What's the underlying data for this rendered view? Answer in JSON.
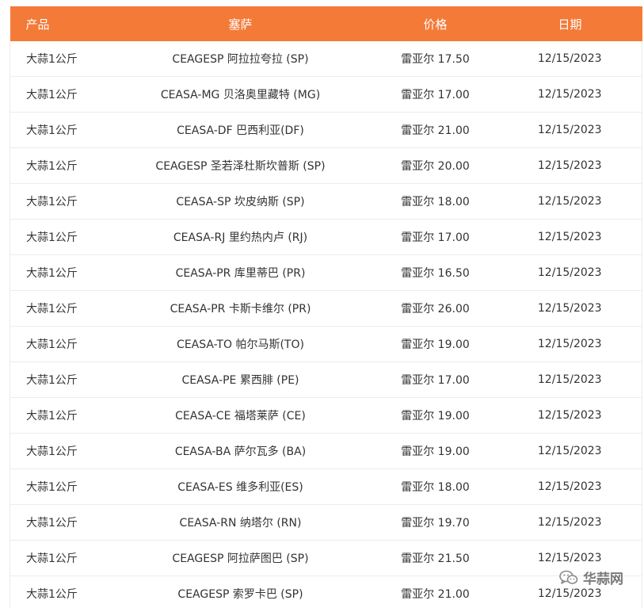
{
  "table": {
    "headers": {
      "product": "产品",
      "ceasa": "塞萨",
      "price": "价格",
      "date": "日期"
    },
    "rows": [
      {
        "product": "大蒜1公斤",
        "ceasa": "CEAGESP 阿拉拉夸拉 (SP)",
        "price": "雷亚尔 17.50",
        "date": "12/15/2023"
      },
      {
        "product": "大蒜1公斤",
        "ceasa": "CEASA-MG 贝洛奥里藏特 (MG)",
        "price": "雷亚尔 17.00",
        "date": "12/15/2023"
      },
      {
        "product": "大蒜1公斤",
        "ceasa": "CEASA-DF 巴西利亚(DF)",
        "price": "雷亚尔 21.00",
        "date": "12/15/2023"
      },
      {
        "product": "大蒜1公斤",
        "ceasa": "CEAGESP 圣若泽杜斯坎普斯 (SP)",
        "price": "雷亚尔 20.00",
        "date": "12/15/2023"
      },
      {
        "product": "大蒜1公斤",
        "ceasa": "CEASA-SP 坎皮纳斯 (SP)",
        "price": "雷亚尔 18.00",
        "date": "12/15/2023"
      },
      {
        "product": "大蒜1公斤",
        "ceasa": "CEASA-RJ 里约热内卢 (RJ)",
        "price": "雷亚尔 17.00",
        "date": "12/15/2023"
      },
      {
        "product": "大蒜1公斤",
        "ceasa": "CEASA-PR 库里蒂巴 (PR)",
        "price": "雷亚尔 16.50",
        "date": "12/15/2023"
      },
      {
        "product": "大蒜1公斤",
        "ceasa": "CEASA-PR 卡斯卡维尔 (PR)",
        "price": "雷亚尔 26.00",
        "date": "12/15/2023"
      },
      {
        "product": "大蒜1公斤",
        "ceasa": "CEASA-TO 帕尔马斯(TO)",
        "price": "雷亚尔 19.00",
        "date": "12/15/2023"
      },
      {
        "product": "大蒜1公斤",
        "ceasa": "CEASA-PE 累西腓 (PE)",
        "price": "雷亚尔 17.00",
        "date": "12/15/2023"
      },
      {
        "product": "大蒜1公斤",
        "ceasa": "CEASA-CE 福塔莱萨 (CE)",
        "price": "雷亚尔 19.00",
        "date": "12/15/2023"
      },
      {
        "product": "大蒜1公斤",
        "ceasa": "CEASA-BA 萨尔瓦多 (BA)",
        "price": "雷亚尔 19.00",
        "date": "12/15/2023"
      },
      {
        "product": "大蒜1公斤",
        "ceasa": "CEASA-ES 维多利亚(ES)",
        "price": "雷亚尔 18.00",
        "date": "12/15/2023"
      },
      {
        "product": "大蒜1公斤",
        "ceasa": "CEASA-RN 纳塔尔 (RN)",
        "price": "雷亚尔 19.70",
        "date": "12/15/2023"
      },
      {
        "product": "大蒜1公斤",
        "ceasa": "CEAGESP 阿拉萨图巴 (SP)",
        "price": "雷亚尔 21.50",
        "date": "12/15/2023"
      },
      {
        "product": "大蒜1公斤",
        "ceasa": "CEAGESP 索罗卡巴 (SP)",
        "price": "雷亚尔 21.00",
        "date": "12/15/2023"
      }
    ]
  },
  "watermark": {
    "text": "华蒜网",
    "icon": "wechat-icon"
  },
  "colors": {
    "header_bg": "#f47a38",
    "header_text": "#ffffff",
    "row_border": "#ececec"
  }
}
